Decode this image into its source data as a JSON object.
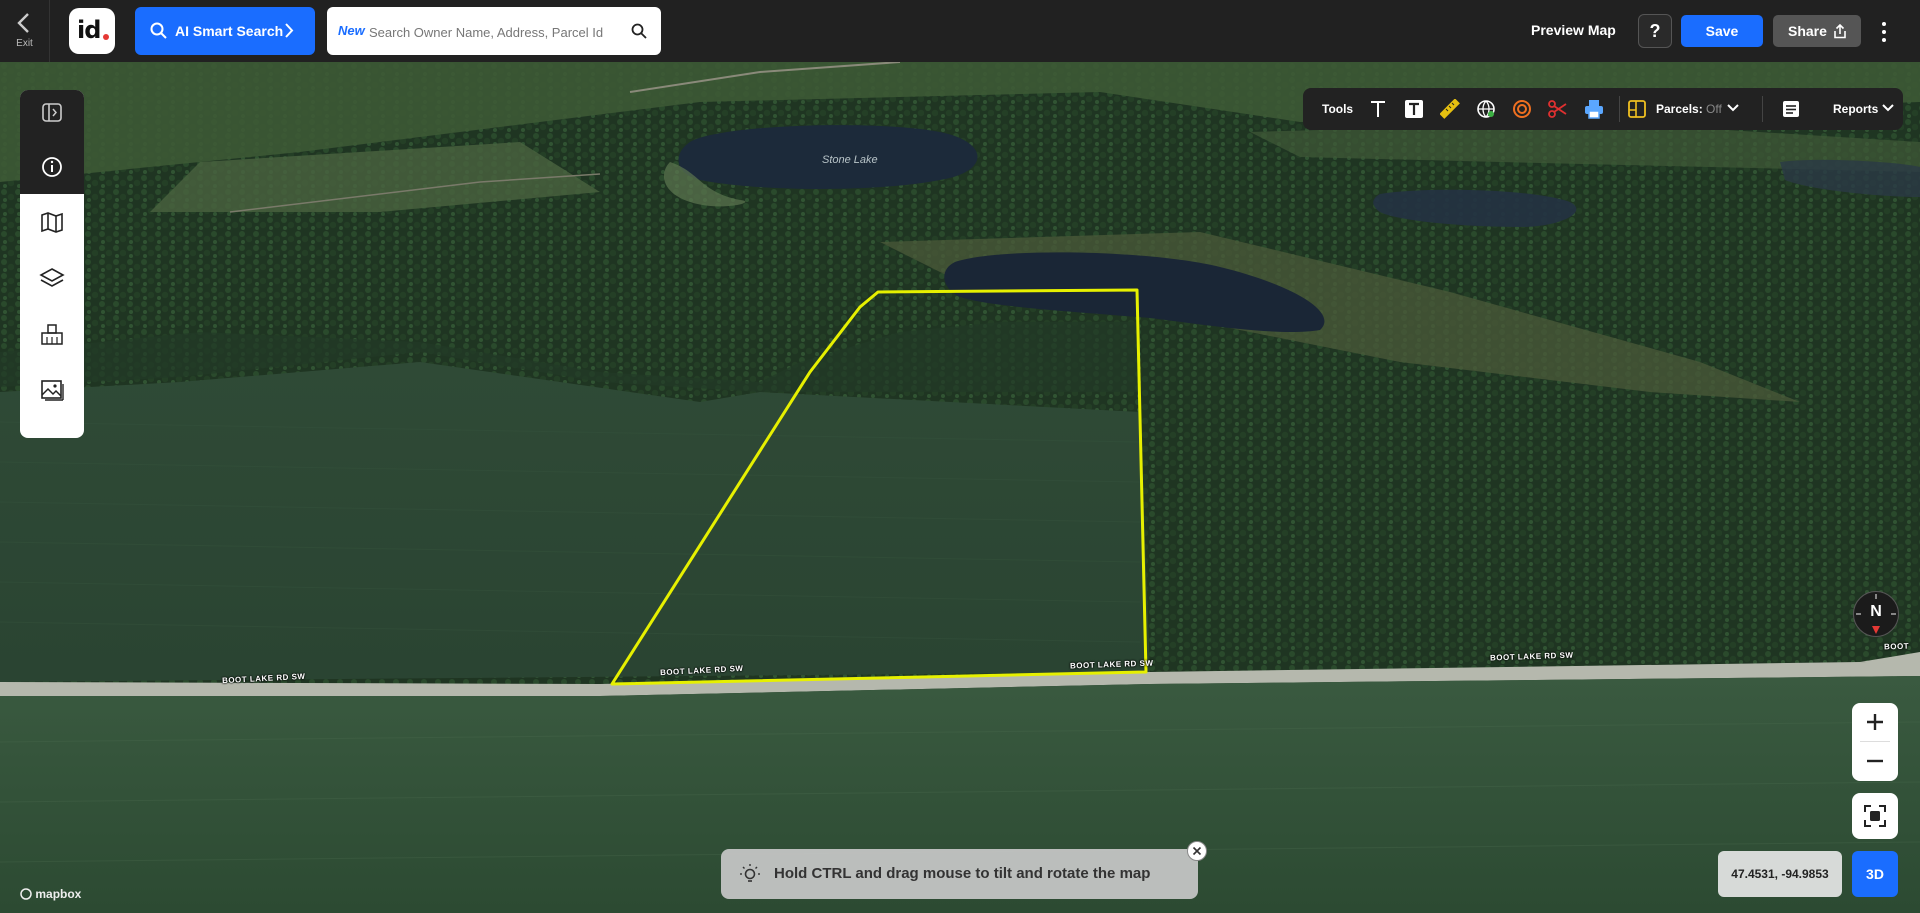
{
  "header": {
    "exit_label": "Exit",
    "logo_text": "id",
    "ai_search_label": "AI Smart Search",
    "search_badge": "New",
    "search_placeholder": "Search Owner Name, Address, Parcel Id",
    "preview_map_label": "Preview Map",
    "help_label": "?",
    "save_label": "Save",
    "share_label": "Share"
  },
  "map": {
    "lake_label": "Stone Lake",
    "road_labels": [
      "BOOT LAKE RD SW",
      "BOOT LAKE RD SW",
      "BOOT LAKE RD SW",
      "BOOT LAKE RD SW",
      "BOOT"
    ],
    "parcel_outline_color": "#e6f000",
    "attribution": "mapbox"
  },
  "left_toolbar": {
    "items": [
      "toggle-panel",
      "info",
      "map",
      "layers",
      "buildings",
      "imagery"
    ]
  },
  "tools_bar": {
    "label": "Tools",
    "parcels_label": "Parcels:",
    "parcels_state": "Off",
    "reports_label": "Reports",
    "icons": [
      "text-icon",
      "text-box-icon",
      "ruler-icon",
      "globe-icon",
      "radius-icon",
      "scissors-icon",
      "print-icon",
      "parcel-icon"
    ]
  },
  "controls": {
    "compass_label": "N",
    "coords": "47.4531, -94.9853",
    "mode_3d_label": "3D"
  },
  "tip": {
    "text": "Hold CTRL and drag mouse to tilt and rotate the map"
  },
  "colors": {
    "accent": "#1a6dff",
    "topbar": "#212121"
  }
}
